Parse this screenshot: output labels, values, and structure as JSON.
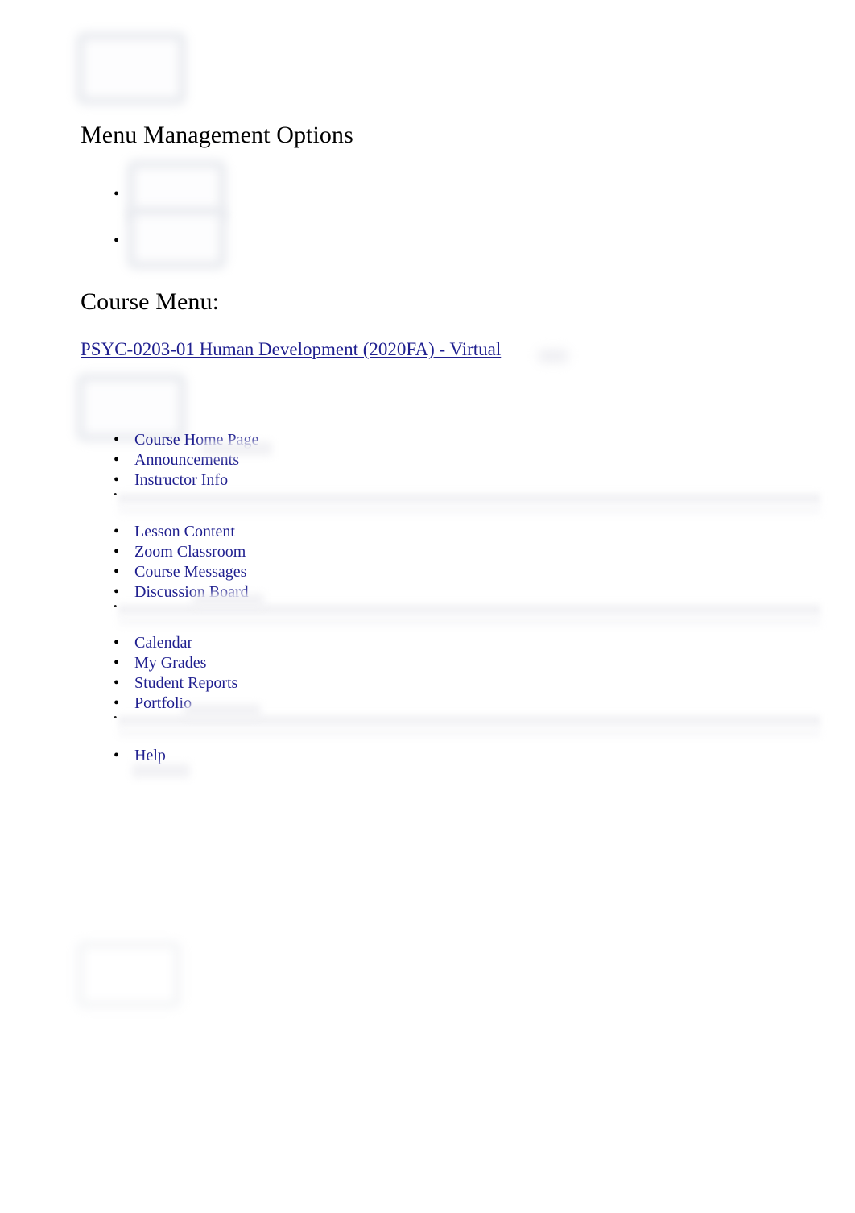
{
  "document": {
    "headings": {
      "menu_management": "Menu Management Options",
      "course_menu": "Course Menu:"
    },
    "course_link": {
      "label": "PSYC-0203-01 Human Development (2020FA) - Virtual",
      "color": "#1f1f8f"
    },
    "top_options_bullets": [
      {
        "label": ""
      },
      {
        "label": ""
      }
    ],
    "menu_groups": [
      {
        "group": "course-info",
        "items": [
          {
            "label": "Course Home Page"
          },
          {
            "label": "Announcements"
          },
          {
            "label": "Instructor Info"
          },
          {
            "label": ""
          }
        ]
      },
      {
        "group": "course-content",
        "items": [
          {
            "label": "Lesson Content"
          },
          {
            "label": "Zoom Classroom"
          },
          {
            "label": "Course Messages"
          },
          {
            "label": "Discussion Board"
          },
          {
            "label": ""
          }
        ]
      },
      {
        "group": "course-tools",
        "items": [
          {
            "label": "Calendar"
          },
          {
            "label": "My Grades"
          },
          {
            "label": "Student Reports"
          },
          {
            "label": "Portfolio"
          },
          {
            "label": ""
          }
        ]
      },
      {
        "group": "course-help",
        "items": [
          {
            "label": "Help"
          }
        ]
      }
    ],
    "redacted_images": [
      {
        "name": "top-toolbar-screenshot"
      },
      {
        "name": "menu-options-screenshot"
      },
      {
        "name": "course-menu-header-screenshot"
      },
      {
        "name": "footer-screenshot"
      }
    ],
    "colors": {
      "link": "#1f1f8f",
      "text": "#000000",
      "page_background": "#ffffff",
      "redaction_border": "#e7e9ee"
    }
  }
}
